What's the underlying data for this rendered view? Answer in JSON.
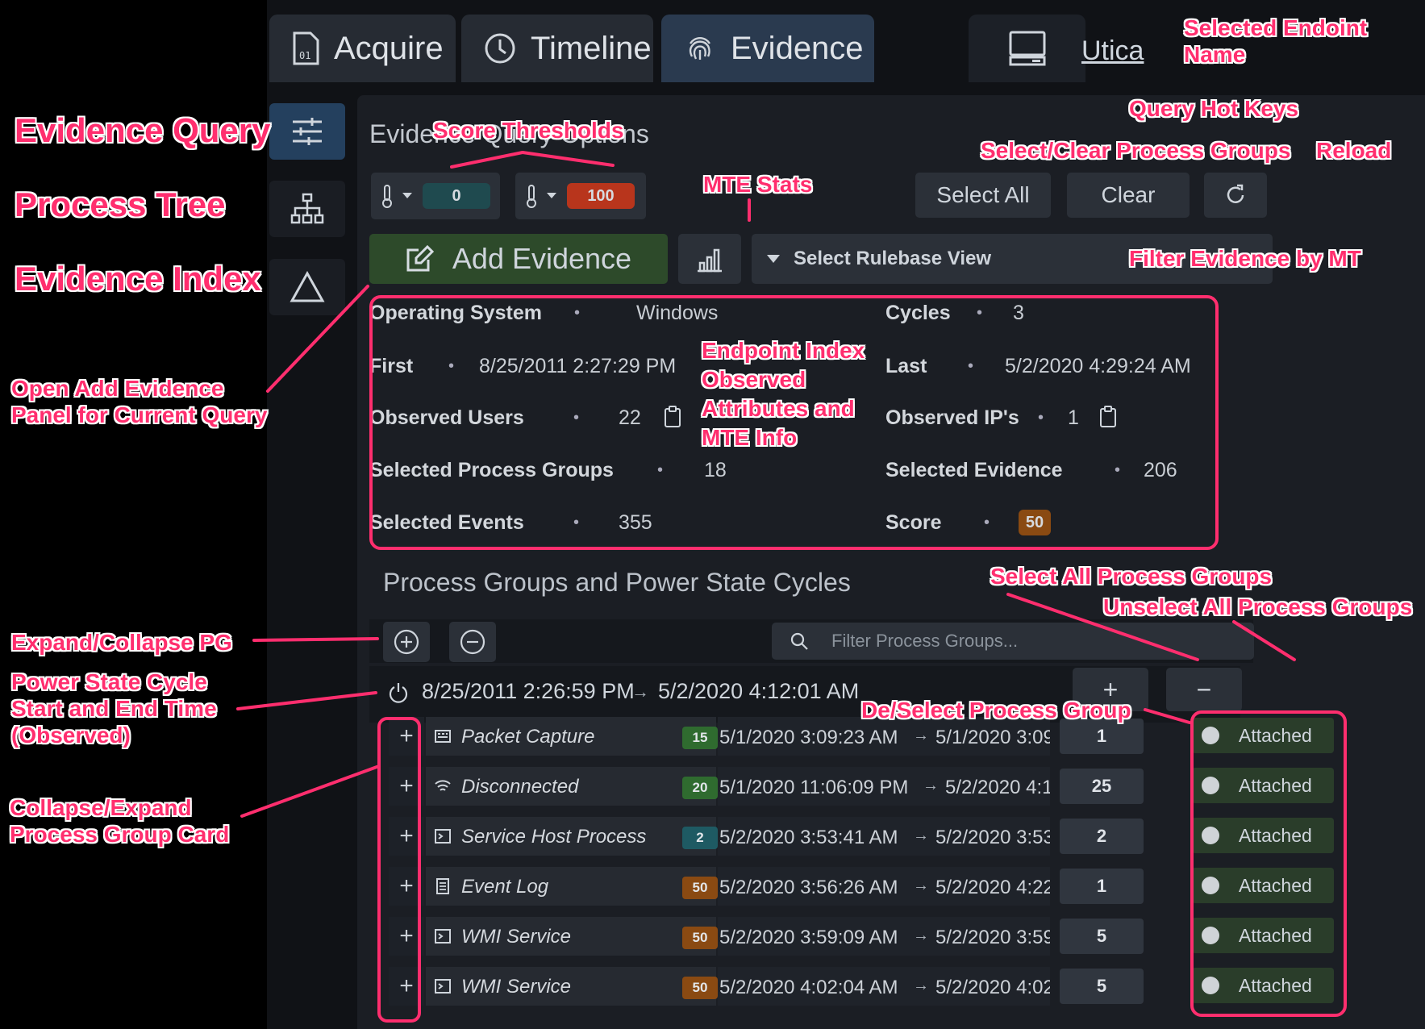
{
  "tabs": [
    {
      "label": "Acquire",
      "icon": "file-binary-icon"
    },
    {
      "label": "Timeline",
      "icon": "clock-icon"
    },
    {
      "label": "Evidence",
      "icon": "fingerprint-icon",
      "active": true
    }
  ],
  "endpoint": {
    "name": "Utica",
    "icon": "computer-icon"
  },
  "side_nav": [
    {
      "name": "evidence-query",
      "icon": "sliders-icon",
      "active": true
    },
    {
      "name": "process-tree",
      "icon": "tree-icon"
    },
    {
      "name": "evidence-index",
      "icon": "triangle-icon"
    }
  ],
  "query": {
    "title": "Evidence Query Options",
    "min_score": "0",
    "max_score": "100",
    "add_evidence_label": "Add Evidence",
    "select_all_label": "Select All",
    "clear_label": "Clear",
    "rulebase_placeholder": "Select Rulebase View"
  },
  "stats": {
    "os_label": "Operating System",
    "os_value": "Windows",
    "cycles_label": "Cycles",
    "cycles_value": "3",
    "first_label": "First",
    "first_value": "8/25/2011 2:27:29 PM",
    "last_label": "Last",
    "last_value": "5/2/2020 4:29:24 AM",
    "users_label": "Observed Users",
    "users_value": "22",
    "ips_label": "Observed IP's",
    "ips_value": "1",
    "pg_label": "Selected Process Groups",
    "pg_value": "18",
    "evidence_label": "Selected Evidence",
    "evidence_value": "206",
    "events_label": "Selected Events",
    "events_value": "355",
    "score_label": "Score",
    "score_value": "50",
    "separator": "•"
  },
  "process_groups": {
    "title": "Process Groups and Power State Cycles",
    "filter_placeholder": "Filter Process Groups...",
    "cycle_start": "8/25/2011 2:26:59 PM",
    "cycle_end": "5/2/2020 4:12:01 AM",
    "rows": [
      {
        "name": "Packet Capture",
        "icon": "network-card-icon",
        "score": "15",
        "score_color": "#2f6b2f",
        "start": "5/1/2020 3:09:23 AM",
        "end": "5/1/2020 3:09...",
        "count": "1",
        "status": "Attached"
      },
      {
        "name": "Disconnected",
        "icon": "wifi-icon",
        "score": "20",
        "score_color": "#2f6b2f",
        "start": "5/1/2020 11:06:09 PM",
        "end": "5/2/2020 4:1...",
        "count": "25",
        "status": "Attached"
      },
      {
        "name": "Service Host Process",
        "icon": "terminal-icon",
        "score": "2",
        "score_color": "#1e5a63",
        "start": "5/2/2020 3:53:41 AM",
        "end": "5/2/2020 3:53...",
        "count": "2",
        "status": "Attached"
      },
      {
        "name": "Event Log",
        "icon": "document-icon",
        "score": "50",
        "score_color": "#8a4a12",
        "start": "5/2/2020 3:56:26 AM",
        "end": "5/2/2020 4:22...",
        "count": "1",
        "status": "Attached"
      },
      {
        "name": "WMI Service",
        "icon": "terminal-icon",
        "score": "50",
        "score_color": "#8a4a12",
        "start": "5/2/2020 3:59:09 AM",
        "end": "5/2/2020 3:59...",
        "count": "5",
        "status": "Attached"
      },
      {
        "name": "WMI Service",
        "icon": "terminal-icon",
        "score": "50",
        "score_color": "#8a4a12",
        "start": "5/2/2020 4:02:04 AM",
        "end": "5/2/2020 4:02...",
        "count": "5",
        "status": "Attached"
      }
    ]
  },
  "annotations": {
    "evidence_query": "Evidence Query",
    "process_tree": "Process Tree",
    "evidence_index": "Evidence Index",
    "open_add_evidence": "Open Add Evidence\nPanel for Current Query",
    "score_thresholds": "Score Thresholds",
    "mte_stats": "MTE Stats",
    "selected_endpoint": "Selected Endoint\nName",
    "query_hot_keys": "Query Hot Keys",
    "select_clear_pg": "Select/Clear Process Groups",
    "reload": "Reload",
    "filter_evidence": "Filter Evidence by MT",
    "endpoint_index": "Endpoint Index\nObserved\nAttributes and\nMTE Info",
    "select_all_pg": "Select All Process Groups",
    "unselect_all_pg": "Unselect All Process Groups",
    "expand_collapse_pg": "Expand/Collapse PG",
    "power_state_cycle": "Power State Cycle\nStart and End Time\n(Observed)",
    "deselect_pg": "De/Select Process Group",
    "collapse_expand_card": "Collapse/Expand\nProcess Group Card"
  },
  "colors": {
    "accent_annotation": "#ff2e6e",
    "attached_bg": "#2a3d2a",
    "active_tab": "#2a3a4f"
  }
}
